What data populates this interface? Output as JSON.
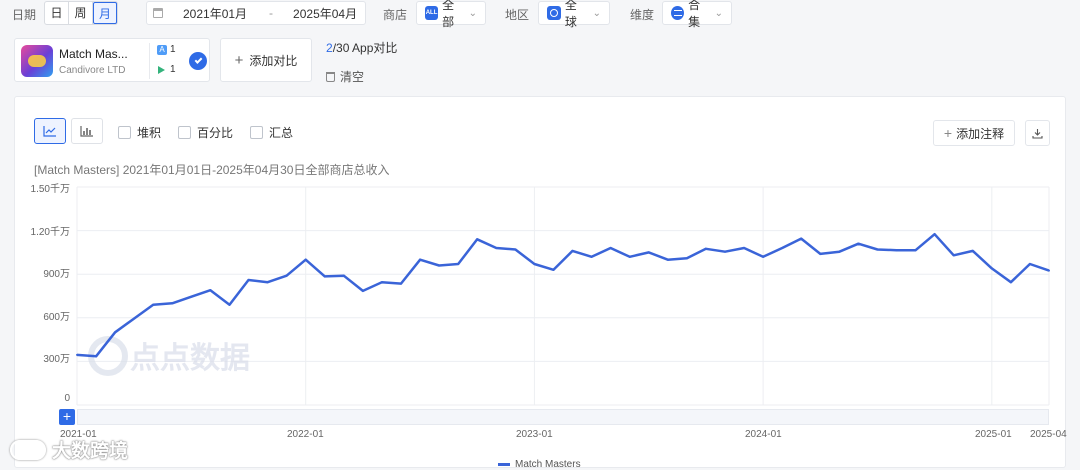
{
  "filters": {
    "date_label": "日期",
    "granularity": [
      "日",
      "周",
      "月"
    ],
    "granularity_active": "月",
    "start_date": "2021年01月",
    "date_sep": "-",
    "end_date": "2025年04月",
    "store_label": "商店",
    "store_badge": "ALL",
    "store_value": "全部",
    "region_label": "地区",
    "region_value": "全球",
    "dimension_label": "维度",
    "dimension_value": "合集"
  },
  "app": {
    "name": "Match Mas...",
    "developer": "Candivore LTD",
    "ios_count": "1",
    "android_count": "1"
  },
  "compare": {
    "add_label": "添加对比",
    "count_current": "2",
    "count_rest": "/30 App对比",
    "clear_label": "清空"
  },
  "toolbar": {
    "stack_label": "堆积",
    "percent_label": "百分比",
    "sum_label": "汇总",
    "annotate_label": "添加注释"
  },
  "watermarks": {
    "chart": "点点数据",
    "corner": "大数跨境"
  },
  "colors": {
    "accent": "#2f6be6",
    "line": "#3a64d8"
  },
  "chart_data": {
    "type": "line",
    "title": "[Match Masters] 2021年01月01日-2025年04月30日全部商店总收入",
    "y_ticks": [
      "0",
      "300万",
      "600万",
      "900万",
      "1.20千万",
      "1.50千万"
    ],
    "ylim": [
      0,
      15000000
    ],
    "x_ticks": [
      {
        "label": "2021-01",
        "index": 0
      },
      {
        "label": "2022-01",
        "index": 12
      },
      {
        "label": "2023-01",
        "index": 24
      },
      {
        "label": "2024-01",
        "index": 36
      },
      {
        "label": "2025-01",
        "index": 48
      },
      {
        "label": "2025-04",
        "index": 51
      }
    ],
    "series": [
      {
        "name": "Match Masters",
        "x": [
          "2021-01",
          "2021-02",
          "2021-03",
          "2021-04",
          "2021-05",
          "2021-06",
          "2021-07",
          "2021-08",
          "2021-09",
          "2021-10",
          "2021-11",
          "2021-12",
          "2022-01",
          "2022-02",
          "2022-03",
          "2022-04",
          "2022-05",
          "2022-06",
          "2022-07",
          "2022-08",
          "2022-09",
          "2022-10",
          "2022-11",
          "2022-12",
          "2023-01",
          "2023-02",
          "2023-03",
          "2023-04",
          "2023-05",
          "2023-06",
          "2023-07",
          "2023-08",
          "2023-09",
          "2023-10",
          "2023-11",
          "2023-12",
          "2024-01",
          "2024-02",
          "2024-03",
          "2024-04",
          "2024-05",
          "2024-06",
          "2024-07",
          "2024-08",
          "2024-09",
          "2024-10",
          "2024-11",
          "2024-12",
          "2025-01",
          "2025-02",
          "2025-03",
          "2025-04"
        ],
        "values": [
          3450000,
          3350000,
          5000000,
          5950000,
          6900000,
          7000000,
          7450000,
          7900000,
          6900000,
          8600000,
          8450000,
          8900000,
          10000000,
          8850000,
          8900000,
          7850000,
          8450000,
          8350000,
          10000000,
          9600000,
          9700000,
          11400000,
          10800000,
          10700000,
          9700000,
          9300000,
          10600000,
          10200000,
          10800000,
          10200000,
          10500000,
          10000000,
          10100000,
          10750000,
          10550000,
          10800000,
          10200000,
          10800000,
          11450000,
          10400000,
          10550000,
          11100000,
          10700000,
          10650000,
          10650000,
          11750000,
          10300000,
          10600000,
          9400000,
          8450000,
          9700000,
          9250000
        ]
      }
    ]
  }
}
